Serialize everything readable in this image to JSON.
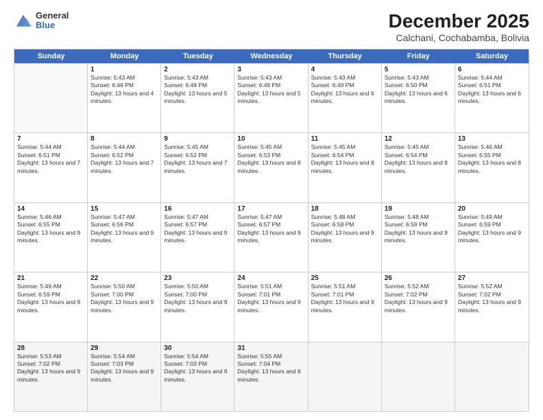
{
  "logo": {
    "general": "General",
    "blue": "Blue"
  },
  "title": {
    "month": "December 2025",
    "location": "Calchani, Cochabamba, Bolivia"
  },
  "header": {
    "days": [
      "Sunday",
      "Monday",
      "Tuesday",
      "Wednesday",
      "Thursday",
      "Friday",
      "Saturday"
    ]
  },
  "weeks": [
    [
      {
        "day": "",
        "empty": true
      },
      {
        "day": "1",
        "sr": "5:43 AM",
        "ss": "6:48 PM",
        "dl": "13 hours and 4 minutes."
      },
      {
        "day": "2",
        "sr": "5:43 AM",
        "ss": "6:48 PM",
        "dl": "13 hours and 5 minutes."
      },
      {
        "day": "3",
        "sr": "5:43 AM",
        "ss": "6:49 PM",
        "dl": "13 hours and 5 minutes."
      },
      {
        "day": "4",
        "sr": "5:43 AM",
        "ss": "6:49 PM",
        "dl": "13 hours and 6 minutes."
      },
      {
        "day": "5",
        "sr": "5:43 AM",
        "ss": "6:50 PM",
        "dl": "13 hours and 6 minutes."
      },
      {
        "day": "6",
        "sr": "5:44 AM",
        "ss": "6:51 PM",
        "dl": "13 hours and 6 minutes."
      }
    ],
    [
      {
        "day": "7",
        "sr": "5:44 AM",
        "ss": "6:51 PM",
        "dl": "13 hours and 7 minutes."
      },
      {
        "day": "8",
        "sr": "5:44 AM",
        "ss": "6:52 PM",
        "dl": "13 hours and 7 minutes."
      },
      {
        "day": "9",
        "sr": "5:45 AM",
        "ss": "6:52 PM",
        "dl": "13 hours and 7 minutes."
      },
      {
        "day": "10",
        "sr": "5:45 AM",
        "ss": "6:53 PM",
        "dl": "13 hours and 8 minutes."
      },
      {
        "day": "11",
        "sr": "5:45 AM",
        "ss": "6:54 PM",
        "dl": "13 hours and 8 minutes."
      },
      {
        "day": "12",
        "sr": "5:45 AM",
        "ss": "6:54 PM",
        "dl": "13 hours and 8 minutes."
      },
      {
        "day": "13",
        "sr": "5:46 AM",
        "ss": "6:55 PM",
        "dl": "13 hours and 8 minutes."
      }
    ],
    [
      {
        "day": "14",
        "sr": "5:46 AM",
        "ss": "6:55 PM",
        "dl": "13 hours and 9 minutes."
      },
      {
        "day": "15",
        "sr": "5:47 AM",
        "ss": "6:56 PM",
        "dl": "13 hours and 9 minutes."
      },
      {
        "day": "16",
        "sr": "5:47 AM",
        "ss": "6:57 PM",
        "dl": "13 hours and 9 minutes."
      },
      {
        "day": "17",
        "sr": "5:47 AM",
        "ss": "6:57 PM",
        "dl": "13 hours and 9 minutes."
      },
      {
        "day": "18",
        "sr": "5:48 AM",
        "ss": "6:58 PM",
        "dl": "13 hours and 9 minutes."
      },
      {
        "day": "19",
        "sr": "5:48 AM",
        "ss": "6:58 PM",
        "dl": "13 hours and 9 minutes."
      },
      {
        "day": "20",
        "sr": "5:49 AM",
        "ss": "6:59 PM",
        "dl": "13 hours and 9 minutes."
      }
    ],
    [
      {
        "day": "21",
        "sr": "5:49 AM",
        "ss": "6:59 PM",
        "dl": "13 hours and 9 minutes."
      },
      {
        "day": "22",
        "sr": "5:50 AM",
        "ss": "7:00 PM",
        "dl": "13 hours and 9 minutes."
      },
      {
        "day": "23",
        "sr": "5:50 AM",
        "ss": "7:00 PM",
        "dl": "13 hours and 9 minutes."
      },
      {
        "day": "24",
        "sr": "5:51 AM",
        "ss": "7:01 PM",
        "dl": "13 hours and 9 minutes."
      },
      {
        "day": "25",
        "sr": "5:51 AM",
        "ss": "7:01 PM",
        "dl": "13 hours and 9 minutes."
      },
      {
        "day": "26",
        "sr": "5:52 AM",
        "ss": "7:02 PM",
        "dl": "13 hours and 9 minutes."
      },
      {
        "day": "27",
        "sr": "5:52 AM",
        "ss": "7:02 PM",
        "dl": "13 hours and 9 minutes."
      }
    ],
    [
      {
        "day": "28",
        "sr": "5:53 AM",
        "ss": "7:02 PM",
        "dl": "13 hours and 9 minutes."
      },
      {
        "day": "29",
        "sr": "5:54 AM",
        "ss": "7:03 PM",
        "dl": "13 hours and 9 minutes."
      },
      {
        "day": "30",
        "sr": "5:54 AM",
        "ss": "7:03 PM",
        "dl": "13 hours and 9 minutes."
      },
      {
        "day": "31",
        "sr": "5:55 AM",
        "ss": "7:04 PM",
        "dl": "13 hours and 8 minutes."
      },
      {
        "day": "",
        "empty": true
      },
      {
        "day": "",
        "empty": true
      },
      {
        "day": "",
        "empty": true
      }
    ]
  ]
}
